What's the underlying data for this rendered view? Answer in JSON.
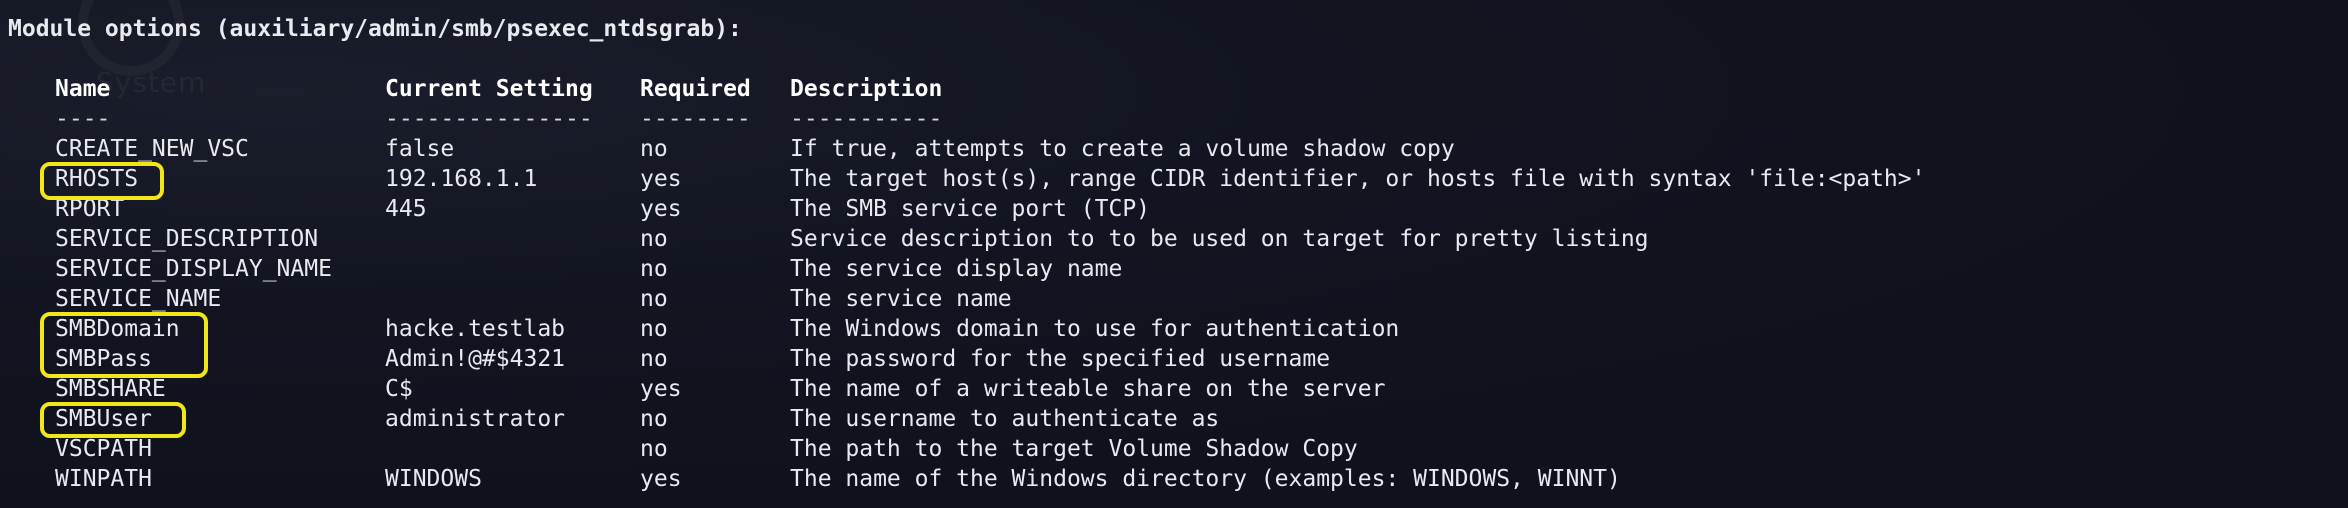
{
  "title": "Module options (auxiliary/admin/smb/psexec_ntdsgrab):",
  "headers": {
    "name": "Name",
    "setting": "Current Setting",
    "required": "Required",
    "description": "Description"
  },
  "dashes": {
    "name": "----",
    "setting": "---------------",
    "required": "--------",
    "description": "-----------"
  },
  "rows": [
    {
      "name": "CREATE_NEW_VSC",
      "setting": "false",
      "required": "no",
      "description": "If true, attempts to create a volume shadow copy"
    },
    {
      "name": "RHOSTS",
      "setting": "192.168.1.1",
      "required": "yes",
      "description": "The target host(s), range CIDR identifier, or hosts file with syntax 'file:<path>'"
    },
    {
      "name": "RPORT",
      "setting": "445",
      "required": "yes",
      "description": "The SMB service port (TCP)"
    },
    {
      "name": "SERVICE_DESCRIPTION",
      "setting": "",
      "required": "no",
      "description": "Service description to to be used on target for pretty listing"
    },
    {
      "name": "SERVICE_DISPLAY_NAME",
      "setting": "",
      "required": "no",
      "description": "The service display name"
    },
    {
      "name": "SERVICE_NAME",
      "setting": "",
      "required": "no",
      "description": "The service name"
    },
    {
      "name": "SMBDomain",
      "setting": "hacke.testlab",
      "required": "no",
      "description": "The Windows domain to use for authentication"
    },
    {
      "name": "SMBPass",
      "setting": "Admin!@#$4321",
      "required": "no",
      "description": "The password for the specified username"
    },
    {
      "name": "SMBSHARE",
      "setting": "C$",
      "required": "yes",
      "description": "The name of a writeable share on the server"
    },
    {
      "name": "SMBUser",
      "setting": "administrator",
      "required": "no",
      "description": "The username to authenticate as"
    },
    {
      "name": "VSCPATH",
      "setting": "",
      "required": "no",
      "description": "The path to the target Volume Shadow Copy"
    },
    {
      "name": "WINPATH",
      "setting": "WINDOWS",
      "required": "yes",
      "description": "The name of the Windows directory (examples: WINDOWS, WINNT)"
    }
  ],
  "colors": {
    "background": "#0f111c",
    "text": "#e9eaf0",
    "highlight": "#f2e51a"
  },
  "watermark_text": "System"
}
